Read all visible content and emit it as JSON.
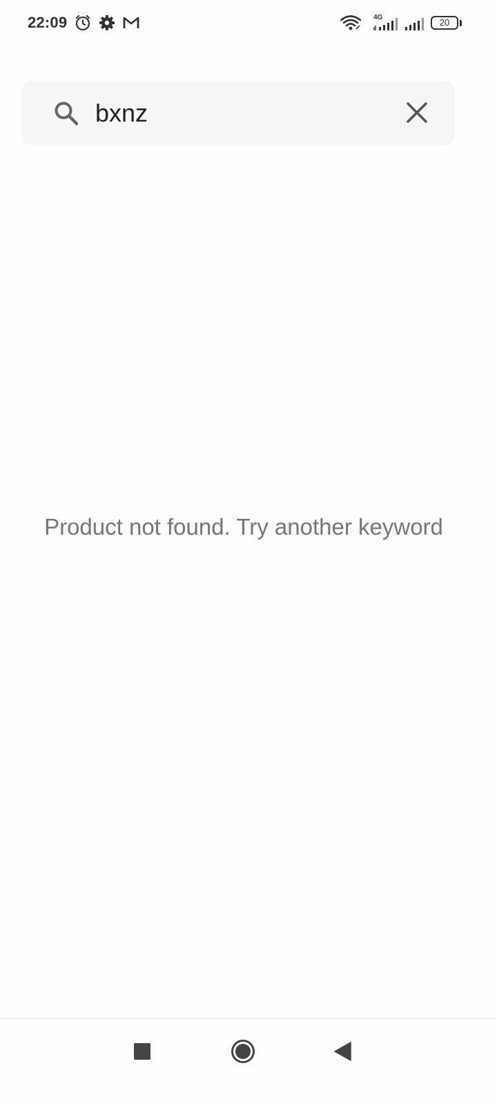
{
  "status_bar": {
    "time": "22:09",
    "network_type": "4G",
    "battery_level": "20",
    "icons": [
      "alarm-icon",
      "settings-icon",
      "gmail-icon",
      "wifi-icon",
      "signal-icon",
      "signal-icon",
      "battery-icon"
    ]
  },
  "search": {
    "value": "bxnz",
    "search_icon": "search-icon",
    "clear_icon": "close-icon"
  },
  "results": {
    "empty_message": "Product not found. Try another keyword"
  },
  "nav_bar": {
    "buttons": [
      "recents-button",
      "home-button",
      "back-button"
    ]
  },
  "colors": {
    "background": "#fefefe",
    "search_background": "#f6f6f6",
    "message_text": "#777777",
    "icon": "#555555"
  }
}
